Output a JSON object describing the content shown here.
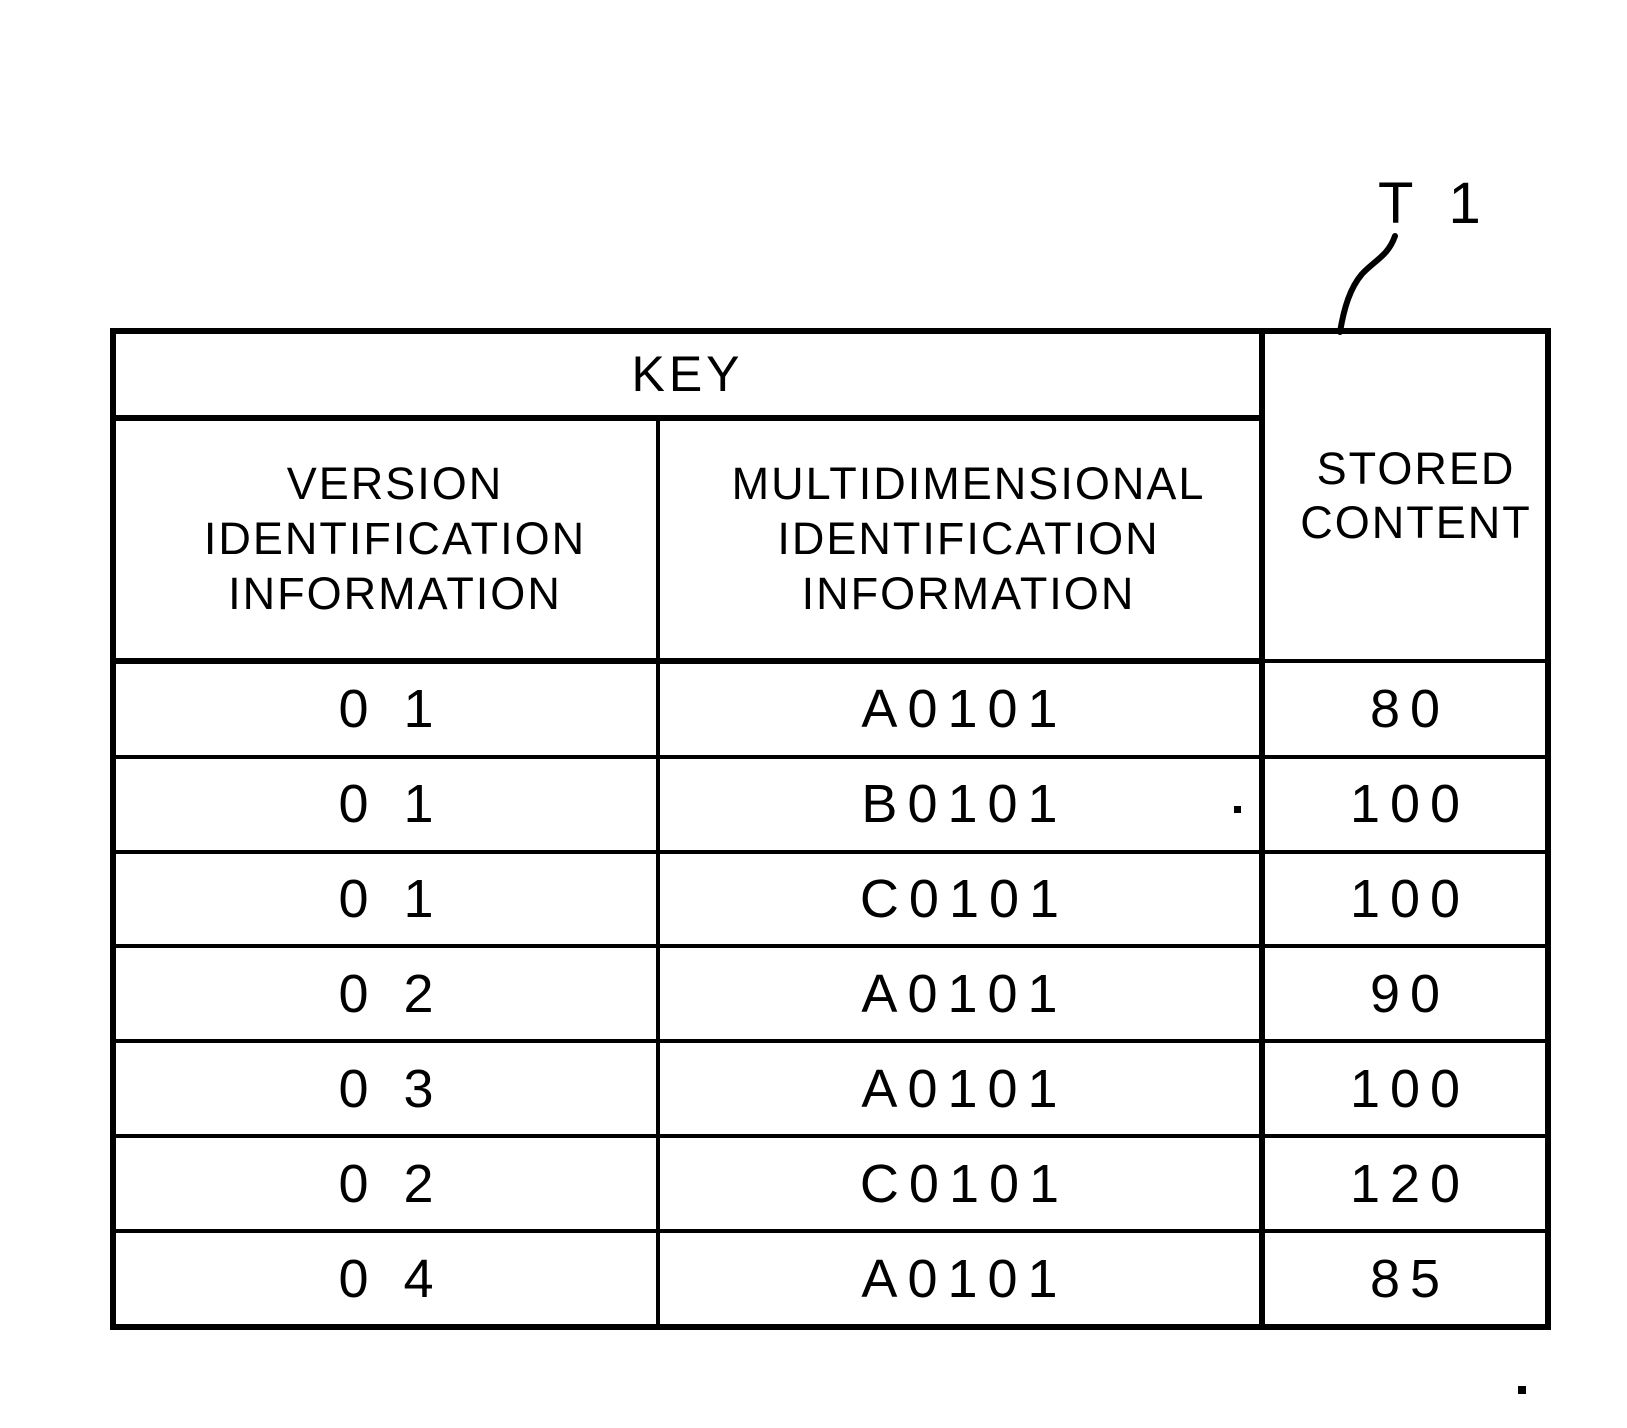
{
  "figure": {
    "reference_label": "T 1"
  },
  "table": {
    "group_header": "KEY",
    "columns": [
      {
        "id": "version",
        "lines": [
          "VERSION",
          "IDENTIFICATION",
          "INFORMATION"
        ]
      },
      {
        "id": "multidimensional",
        "lines": [
          "MULTIDIMENSIONAL",
          "IDENTIFICATION",
          "INFORMATION"
        ]
      },
      {
        "id": "stored",
        "lines": [
          "STORED",
          "CONTENT"
        ]
      }
    ],
    "rows": [
      {
        "version": "0 1",
        "multidimensional": "A0101",
        "stored": "80"
      },
      {
        "version": "0 1",
        "multidimensional": "B0101",
        "stored": "100"
      },
      {
        "version": "0 1",
        "multidimensional": "C0101",
        "stored": "100"
      },
      {
        "version": "0 2",
        "multidimensional": "A0101",
        "stored": "90"
      },
      {
        "version": "0 3",
        "multidimensional": "A0101",
        "stored": "100"
      },
      {
        "version": "0 2",
        "multidimensional": "C0101",
        "stored": "120"
      },
      {
        "version": "0 4",
        "multidimensional": "A0101",
        "stored": "85"
      }
    ]
  },
  "colors": {
    "ink": "#000000",
    "paper": "#ffffff"
  }
}
